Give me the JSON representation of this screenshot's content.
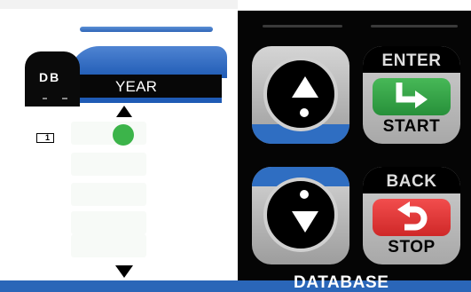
{
  "lcd": {
    "db_label": "DB",
    "header_label": "YEAR",
    "box_indicator": "1",
    "status_color": "#3cb44a"
  },
  "keypad": {
    "scroll_up": {
      "icon": "up-arrow-icon"
    },
    "scroll_down": {
      "icon": "down-arrow-icon"
    },
    "enter_start": {
      "top_label": "ENTER",
      "bottom_label": "START",
      "icon": "enter-arrow-icon",
      "color": "#3aa84a"
    },
    "back_stop": {
      "top_label": "BACK",
      "bottom_label": "STOP",
      "icon": "back-arrow-icon",
      "color": "#e23a3a"
    }
  },
  "footer": {
    "mode_label": "DATABASE"
  },
  "colors": {
    "accent": "#2a66b8",
    "panel": "#050505"
  }
}
